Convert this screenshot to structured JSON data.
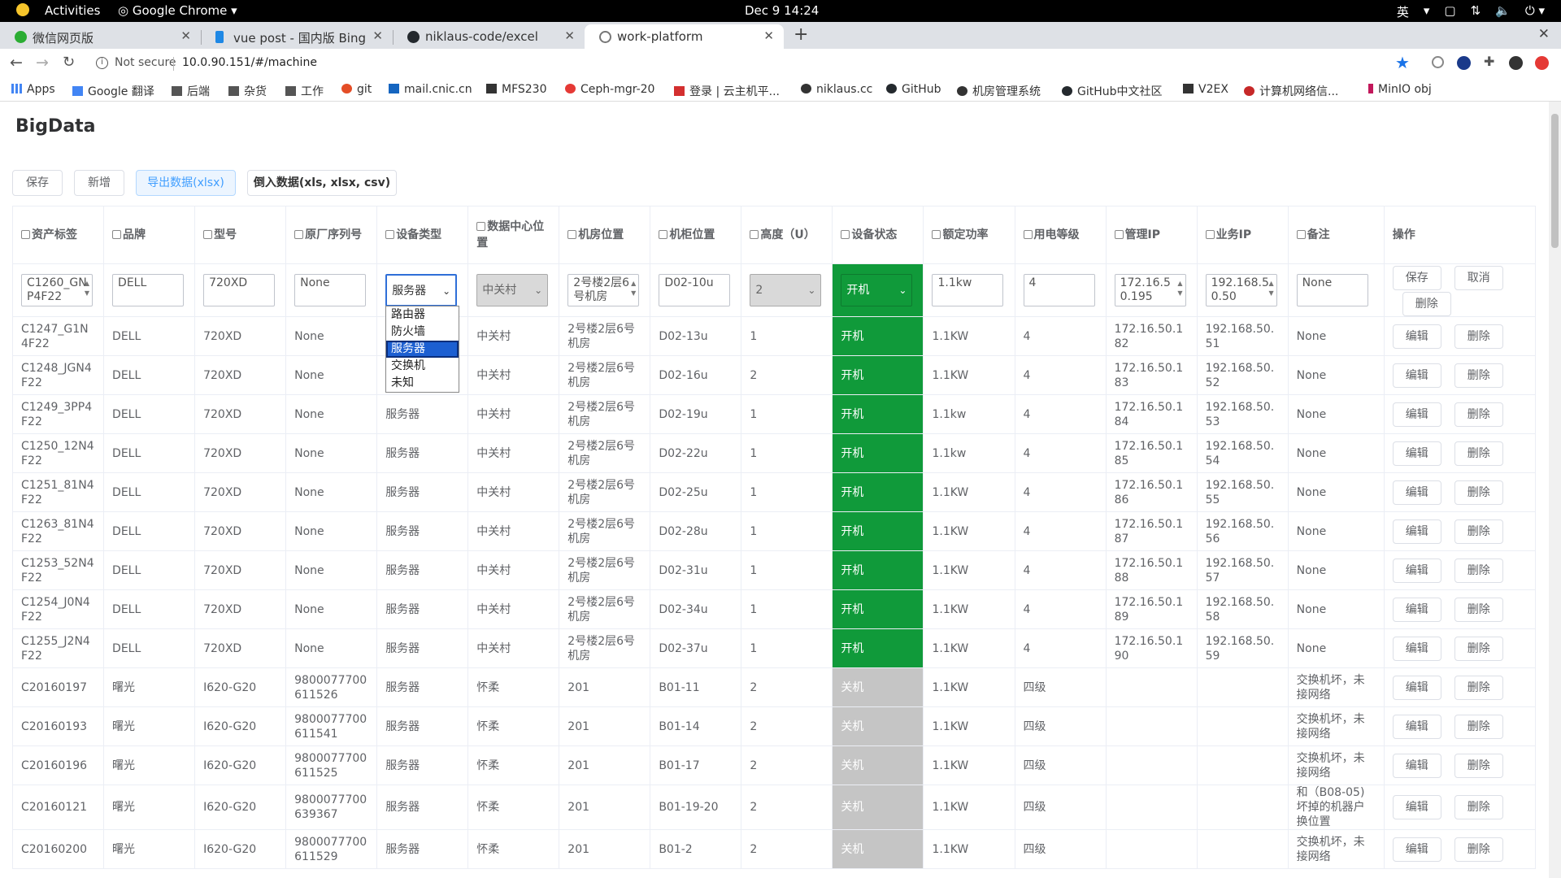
{
  "system": {
    "activities": "Activities",
    "app_menu": "Google Chrome",
    "clock": "Dec 9  14:24",
    "ime": "英"
  },
  "tabs": [
    {
      "label": "微信网页版",
      "color": "#2bad33"
    },
    {
      "label": "vue post - 国内版 Bing",
      "color": "#1e88e5"
    },
    {
      "label": "niklaus-code/excel",
      "color": "#24292e"
    },
    {
      "label": "work-platform",
      "color": "#888888"
    }
  ],
  "omnibox": {
    "security": "Not secure",
    "url": "10.0.90.151/#/machine"
  },
  "bookmarks": [
    "Apps",
    "Google 翻译",
    "后端",
    "杂货",
    "工作",
    "git",
    "mail.cnic.cn",
    "MFS230",
    "Ceph-mgr-20",
    "登录 | 云主机平...",
    "niklaus.cc",
    "GitHub",
    "机房管理系统",
    "GitHub中文社区",
    "V2EX",
    "计算机网络信...",
    "MinIO obj"
  ],
  "app": {
    "title": "BigData",
    "toolbar": {
      "save": "保存",
      "add": "新增",
      "export": "导出数据(xlsx)",
      "import": "倒入数据(xls, xlsx, csv)"
    }
  },
  "table": {
    "headers": [
      "资产标签",
      "品牌",
      "型号",
      "原厂序列号",
      "设备类型",
      "数据中心位置",
      "机房位置",
      "机柜位置",
      "高度（U）",
      "设备状态",
      "额定功率",
      "用电等级",
      "管理IP",
      "业务IP",
      "备注",
      "操作"
    ],
    "edit_row": {
      "asset": "C1260_GNP4F22",
      "brand": "DELL",
      "model": "720XD",
      "serial": "None",
      "type": "服务器",
      "dc": "中关村",
      "room": "2号楼2层6号机房",
      "rack": "D02-10u",
      "height": "2",
      "status": "开机",
      "power": "1.1kw",
      "level": "4",
      "mgmt_ip": "172.16.50.195",
      "biz_ip": "192.168.50.50",
      "note": "None",
      "save": "保存",
      "cancel": "取消",
      "delete": "删除"
    },
    "type_options": [
      "路由器",
      "防火墙",
      "服务器",
      "交换机",
      "未知"
    ],
    "type_selected": "服务器",
    "row_actions": {
      "edit": "编辑",
      "delete": "删除"
    },
    "rows": [
      {
        "asset": "C1247_G1N4F22",
        "brand": "DELL",
        "model": "720XD",
        "serial": "None",
        "type": "",
        "dc": "中关村",
        "room": "2号楼2层6号机房",
        "rack": "D02-13u",
        "height": "1",
        "status": "开机",
        "power": "1.1KW",
        "level": "4",
        "mgmt_ip": "172.16.50.182",
        "biz_ip": "192.168.50.51",
        "note": "None"
      },
      {
        "asset": "C1248_JGN4F22",
        "brand": "DELL",
        "model": "720XD",
        "serial": "None",
        "type": "",
        "dc": "中关村",
        "room": "2号楼2层6号机房",
        "rack": "D02-16u",
        "height": "2",
        "status": "开机",
        "power": "1.1KW",
        "level": "4",
        "mgmt_ip": "172.16.50.183",
        "biz_ip": "192.168.50.52",
        "note": "None"
      },
      {
        "asset": "C1249_3PP4F22",
        "brand": "DELL",
        "model": "720XD",
        "serial": "None",
        "type": "服务器",
        "dc": "中关村",
        "room": "2号楼2层6号机房",
        "rack": "D02-19u",
        "height": "1",
        "status": "开机",
        "power": "1.1kw",
        "level": "4",
        "mgmt_ip": "172.16.50.184",
        "biz_ip": "192.168.50.53",
        "note": "None"
      },
      {
        "asset": "C1250_12N4F22",
        "brand": "DELL",
        "model": "720XD",
        "serial": "None",
        "type": "服务器",
        "dc": "中关村",
        "room": "2号楼2层6号机房",
        "rack": "D02-22u",
        "height": "1",
        "status": "开机",
        "power": "1.1kw",
        "level": "4",
        "mgmt_ip": "172.16.50.185",
        "biz_ip": "192.168.50.54",
        "note": "None"
      },
      {
        "asset": "C1251_81N4F22",
        "brand": "DELL",
        "model": "720XD",
        "serial": "None",
        "type": "服务器",
        "dc": "中关村",
        "room": "2号楼2层6号机房",
        "rack": "D02-25u",
        "height": "1",
        "status": "开机",
        "power": "1.1KW",
        "level": "4",
        "mgmt_ip": "172.16.50.186",
        "biz_ip": "192.168.50.55",
        "note": "None"
      },
      {
        "asset": "C1263_81N4F22",
        "brand": "DELL",
        "model": "720XD",
        "serial": "None",
        "type": "服务器",
        "dc": "中关村",
        "room": "2号楼2层6号机房",
        "rack": "D02-28u",
        "height": "1",
        "status": "开机",
        "power": "1.1KW",
        "level": "4",
        "mgmt_ip": "172.16.50.187",
        "biz_ip": "192.168.50.56",
        "note": "None"
      },
      {
        "asset": "C1253_52N4F22",
        "brand": "DELL",
        "model": "720XD",
        "serial": "None",
        "type": "服务器",
        "dc": "中关村",
        "room": "2号楼2层6号机房",
        "rack": "D02-31u",
        "height": "1",
        "status": "开机",
        "power": "1.1KW",
        "level": "4",
        "mgmt_ip": "172.16.50.188",
        "biz_ip": "192.168.50.57",
        "note": "None"
      },
      {
        "asset": "C1254_J0N4F22",
        "brand": "DELL",
        "model": "720XD",
        "serial": "None",
        "type": "服务器",
        "dc": "中关村",
        "room": "2号楼2层6号机房",
        "rack": "D02-34u",
        "height": "1",
        "status": "开机",
        "power": "1.1KW",
        "level": "4",
        "mgmt_ip": "172.16.50.189",
        "biz_ip": "192.168.50.58",
        "note": "None"
      },
      {
        "asset": "C1255_J2N4F22",
        "brand": "DELL",
        "model": "720XD",
        "serial": "None",
        "type": "服务器",
        "dc": "中关村",
        "room": "2号楼2层6号机房",
        "rack": "D02-37u",
        "height": "1",
        "status": "开机",
        "power": "1.1KW",
        "level": "4",
        "mgmt_ip": "172.16.50.190",
        "biz_ip": "192.168.50.59",
        "note": "None"
      },
      {
        "asset": "C20160197",
        "brand": "曙光",
        "model": "I620-G20",
        "serial": "9800077700611526",
        "type": "服务器",
        "dc": "怀柔",
        "room": "201",
        "rack": "B01-11",
        "height": "2",
        "status": "关机",
        "power": "1.1KW",
        "level": "四级",
        "mgmt_ip": "",
        "biz_ip": "",
        "note": "交换机坏，未接网络"
      },
      {
        "asset": "C20160193",
        "brand": "曙光",
        "model": "I620-G20",
        "serial": "9800077700611541",
        "type": "服务器",
        "dc": "怀柔",
        "room": "201",
        "rack": "B01-14",
        "height": "2",
        "status": "关机",
        "power": "1.1KW",
        "level": "四级",
        "mgmt_ip": "",
        "biz_ip": "",
        "note": "交换机坏，未接网络"
      },
      {
        "asset": "C20160196",
        "brand": "曙光",
        "model": "I620-G20",
        "serial": "9800077700611525",
        "type": "服务器",
        "dc": "怀柔",
        "room": "201",
        "rack": "B01-17",
        "height": "2",
        "status": "关机",
        "power": "1.1KW",
        "level": "四级",
        "mgmt_ip": "",
        "biz_ip": "",
        "note": "交换机坏，未接网络"
      },
      {
        "asset": "C20160121",
        "brand": "曙光",
        "model": "I620-G20",
        "serial": "9800077700639367",
        "type": "服务器",
        "dc": "怀柔",
        "room": "201",
        "rack": "B01-19-20",
        "height": "2",
        "status": "关机",
        "power": "1.1KW",
        "level": "四级",
        "mgmt_ip": "",
        "biz_ip": "",
        "note": "和（B08-05)坏掉的机器户换位置"
      },
      {
        "asset": "C20160200",
        "brand": "曙光",
        "model": "I620-G20",
        "serial": "9800077700611529",
        "type": "服务器",
        "dc": "怀柔",
        "room": "201",
        "rack": "B01-2",
        "height": "2",
        "status": "关机",
        "power": "1.1KW",
        "level": "四级",
        "mgmt_ip": "",
        "biz_ip": "",
        "note": "交换机坏，未接网络"
      }
    ]
  },
  "colors": {
    "on": "#109a3a",
    "off": "#c5c5c5",
    "primary": "#409eff"
  }
}
